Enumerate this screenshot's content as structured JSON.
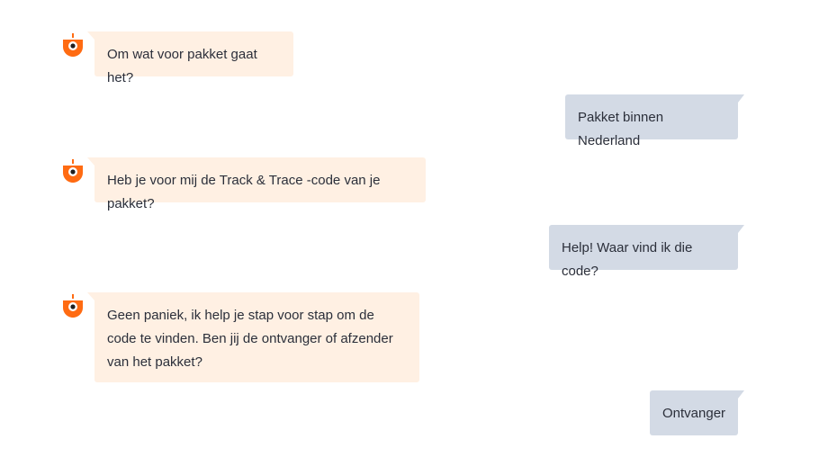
{
  "messages": [
    {
      "from": "bot",
      "text": "Om wat voor pakket gaat het?"
    },
    {
      "from": "user",
      "text": "Pakket binnen Nederland"
    },
    {
      "from": "bot",
      "text": "Heb je voor mij de Track & Trace -code van je pakket?"
    },
    {
      "from": "user",
      "text": "Help! Waar vind ik die code?"
    },
    {
      "from": "bot",
      "text": "Geen paniek, ik help je stap voor stap om de code te vinden. Ben jij de ontvanger of afzender van het pakket?"
    },
    {
      "from": "user",
      "text": "Ontvanger"
    }
  ],
  "colors": {
    "bot_bubble": "#fff0e3",
    "user_bubble": "#d3dae5",
    "avatar_orange": "#ff6b12",
    "text": "#2b2f3a"
  },
  "icons": {
    "bot_avatar": "robot-avatar-icon"
  }
}
